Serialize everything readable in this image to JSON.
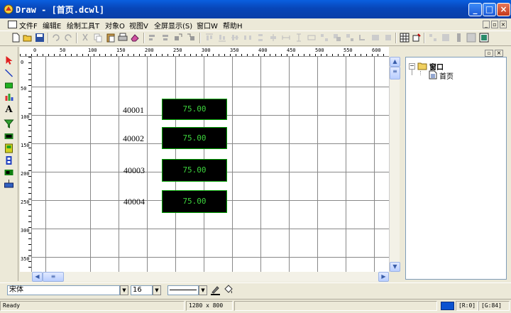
{
  "window": {
    "title": "Draw - [首页.dcwl]"
  },
  "menu": {
    "items": [
      {
        "label": "文件F"
      },
      {
        "label": "编辑E"
      },
      {
        "label": "绘制工具T"
      },
      {
        "label": "对象O"
      },
      {
        "label": "视图V"
      },
      {
        "label": "全屏显示(S)"
      },
      {
        "label": "窗口W"
      },
      {
        "label": "帮助H"
      }
    ]
  },
  "ruler": {
    "top": [
      "0",
      "50",
      "100",
      "150",
      "200",
      "250",
      "300",
      "350",
      "400",
      "450",
      "500",
      "550",
      "600"
    ],
    "left": [
      "0",
      "50",
      "100",
      "150",
      "200",
      "250",
      "300",
      "350"
    ]
  },
  "canvas": {
    "widgets": [
      {
        "label": "40001",
        "value": "75.00"
      },
      {
        "label": "40002",
        "value": "75.00"
      },
      {
        "label": "40003",
        "value": "75.00"
      },
      {
        "label": "40004",
        "value": "75.00"
      }
    ]
  },
  "tree": {
    "root": "窗口",
    "child": "首页"
  },
  "formatbar": {
    "font_name": "宋体",
    "font_size": "16"
  },
  "status": {
    "state": "Ready",
    "resolution": "1280 x 800",
    "r_value": "[R:0]",
    "g_value": "[G:84]"
  },
  "colors": {
    "value_text": "#3cd23c",
    "value_bg": "#000000",
    "value_border": "#00a000",
    "titlebar": "#0a5fe0",
    "status_swatch": "#0a52d0"
  },
  "icons": {
    "toolbar": [
      "new-icon",
      "open-icon",
      "save-icon",
      "undo-icon",
      "redo-icon",
      "cut-icon",
      "copy-icon",
      "paste-icon",
      "print-icon",
      "eraser-icon"
    ],
    "tools": [
      "pointer-icon",
      "line-icon",
      "rectangle-icon",
      "chart-icon",
      "text-icon",
      "filter-icon",
      "bitmap-icon",
      "meter-icon",
      "switch-icon",
      "indicator-icon",
      "button-icon"
    ]
  }
}
